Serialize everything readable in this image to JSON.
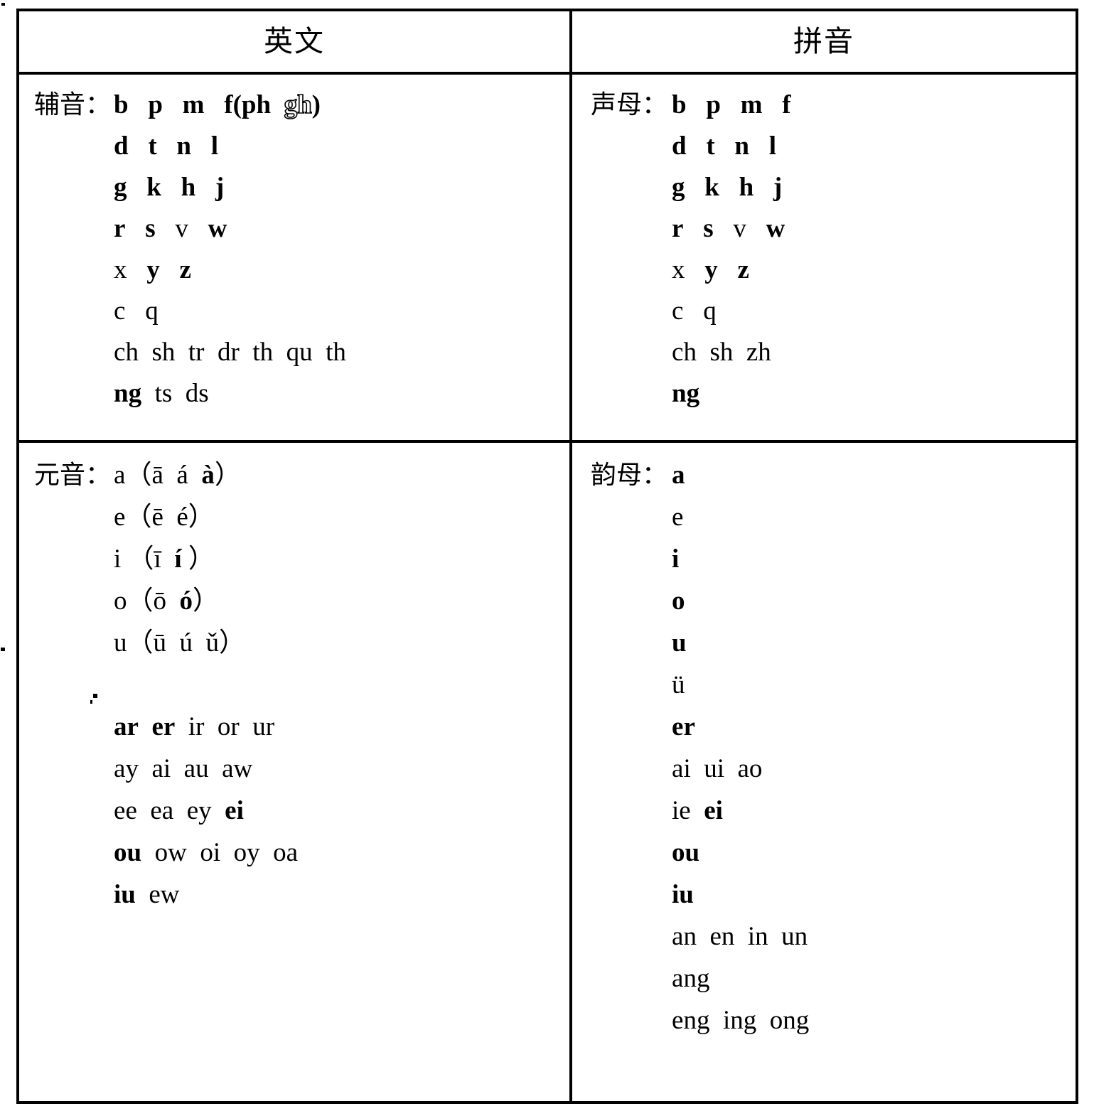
{
  "table": {
    "headers": {
      "english": "英文",
      "pinyin": "拼音"
    },
    "consonants": {
      "english": {
        "label": "辅音：",
        "lines": [
          [
            {
              "t": "b",
              "b": true
            },
            {
              "t": "   "
            },
            {
              "t": "p",
              "b": true
            },
            {
              "t": "   "
            },
            {
              "t": "m",
              "b": true
            },
            {
              "t": "   "
            },
            {
              "t": "f(ph",
              "b": true
            },
            {
              "t": "  "
            },
            {
              "t": "gh",
              "hollow": true
            },
            {
              "t": ")",
              "b": true
            }
          ],
          [
            {
              "t": "d",
              "b": true
            },
            {
              "t": "   "
            },
            {
              "t": "t",
              "b": true
            },
            {
              "t": "   "
            },
            {
              "t": "n",
              "b": true
            },
            {
              "t": "   "
            },
            {
              "t": "l",
              "b": true
            }
          ],
          [
            {
              "t": "g",
              "b": true
            },
            {
              "t": "   "
            },
            {
              "t": "k",
              "b": true
            },
            {
              "t": "   "
            },
            {
              "t": "h",
              "b": true
            },
            {
              "t": "   "
            },
            {
              "t": "j",
              "b": true
            }
          ],
          [
            {
              "t": "r",
              "b": true
            },
            {
              "t": "   "
            },
            {
              "t": "s",
              "b": true
            },
            {
              "t": "   "
            },
            {
              "t": "v"
            },
            {
              "t": "   "
            },
            {
              "t": "w",
              "b": true
            }
          ],
          [
            {
              "t": "x"
            },
            {
              "t": "   "
            },
            {
              "t": "y",
              "b": true
            },
            {
              "t": "   "
            },
            {
              "t": "z",
              "b": true
            }
          ],
          [
            {
              "t": "c"
            },
            {
              "t": "   "
            },
            {
              "t": "q"
            }
          ],
          [
            {
              "t": "ch"
            },
            {
              "t": "  "
            },
            {
              "t": "sh"
            },
            {
              "t": "  "
            },
            {
              "t": "tr"
            },
            {
              "t": "  "
            },
            {
              "t": "dr"
            },
            {
              "t": "  "
            },
            {
              "t": "th"
            },
            {
              "t": "  "
            },
            {
              "t": "qu"
            },
            {
              "t": "  "
            },
            {
              "t": "th"
            }
          ],
          [
            {
              "t": "ng",
              "b": true
            },
            {
              "t": "  "
            },
            {
              "t": "ts"
            },
            {
              "t": "  "
            },
            {
              "t": "ds"
            }
          ]
        ]
      },
      "pinyin": {
        "label": "声母：",
        "lines": [
          [
            {
              "t": "b",
              "b": true
            },
            {
              "t": "   "
            },
            {
              "t": "p",
              "b": true
            },
            {
              "t": "   "
            },
            {
              "t": "m",
              "b": true
            },
            {
              "t": "   "
            },
            {
              "t": "f",
              "b": true
            }
          ],
          [
            {
              "t": "d",
              "b": true
            },
            {
              "t": "   "
            },
            {
              "t": "t",
              "b": true
            },
            {
              "t": "   "
            },
            {
              "t": "n",
              "b": true
            },
            {
              "t": "   "
            },
            {
              "t": "l",
              "b": true
            }
          ],
          [
            {
              "t": "g",
              "b": true
            },
            {
              "t": "   "
            },
            {
              "t": "k",
              "b": true
            },
            {
              "t": "   "
            },
            {
              "t": "h",
              "b": true
            },
            {
              "t": "   "
            },
            {
              "t": "j",
              "b": true
            }
          ],
          [
            {
              "t": "r",
              "b": true
            },
            {
              "t": "   "
            },
            {
              "t": "s",
              "b": true
            },
            {
              "t": "   "
            },
            {
              "t": "v"
            },
            {
              "t": "   "
            },
            {
              "t": "w",
              "b": true
            }
          ],
          [
            {
              "t": "x"
            },
            {
              "t": "   "
            },
            {
              "t": "y",
              "b": true
            },
            {
              "t": "   "
            },
            {
              "t": "z",
              "b": true
            }
          ],
          [
            {
              "t": "c"
            },
            {
              "t": "   "
            },
            {
              "t": "q"
            }
          ],
          [
            {
              "t": "ch"
            },
            {
              "t": "  "
            },
            {
              "t": "sh"
            },
            {
              "t": "  "
            },
            {
              "t": "zh"
            }
          ],
          [
            {
              "t": "ng",
              "b": true
            }
          ]
        ]
      }
    },
    "vowels": {
      "english": {
        "label": "元音：",
        "lines": [
          [
            {
              "t": "a（ā"
            },
            {
              "t": "  "
            },
            {
              "t": "á"
            },
            {
              "t": "  "
            },
            {
              "t": "à",
              "b": true
            },
            {
              "t": "）"
            }
          ],
          [
            {
              "t": "e（ē"
            },
            {
              "t": "  "
            },
            {
              "t": "é）"
            }
          ],
          [
            {
              "t": "i （ī"
            },
            {
              "t": "  "
            },
            {
              "t": "í",
              "b": true
            },
            {
              "t": " ）"
            }
          ],
          [
            {
              "t": "o（ō"
            },
            {
              "t": "  "
            },
            {
              "t": "ó",
              "b": true
            },
            {
              "t": "）"
            }
          ],
          [
            {
              "t": "u（ū"
            },
            {
              "t": "  "
            },
            {
              "t": "ú"
            },
            {
              "t": "  "
            },
            {
              "t": "ǔ）"
            }
          ],
          [],
          [
            {
              "t": "ar",
              "b": true
            },
            {
              "t": "  "
            },
            {
              "t": "er",
              "b": true
            },
            {
              "t": "  "
            },
            {
              "t": "ir"
            },
            {
              "t": "  "
            },
            {
              "t": "or"
            },
            {
              "t": "  "
            },
            {
              "t": "ur"
            }
          ],
          [
            {
              "t": "ay"
            },
            {
              "t": "  "
            },
            {
              "t": "ai"
            },
            {
              "t": "  "
            },
            {
              "t": "au"
            },
            {
              "t": "  "
            },
            {
              "t": "aw"
            }
          ],
          [
            {
              "t": "ee"
            },
            {
              "t": "  "
            },
            {
              "t": "ea"
            },
            {
              "t": "  "
            },
            {
              "t": "ey"
            },
            {
              "t": "  "
            },
            {
              "t": "ei",
              "b": true
            }
          ],
          [
            {
              "t": "ou",
              "b": true
            },
            {
              "t": "  "
            },
            {
              "t": "ow"
            },
            {
              "t": "  "
            },
            {
              "t": "oi"
            },
            {
              "t": "  "
            },
            {
              "t": "oy"
            },
            {
              "t": "  "
            },
            {
              "t": "oa"
            }
          ],
          [
            {
              "t": "iu",
              "b": true
            },
            {
              "t": "  "
            },
            {
              "t": "ew"
            }
          ]
        ]
      },
      "pinyin": {
        "label": "韵母：",
        "lines": [
          [
            {
              "t": "a",
              "b": true
            }
          ],
          [
            {
              "t": "e"
            }
          ],
          [
            {
              "t": "i",
              "b": true
            }
          ],
          [
            {
              "t": "o",
              "b": true
            }
          ],
          [
            {
              "t": "u",
              "b": true
            }
          ],
          [
            {
              "t": "ü"
            }
          ],
          [
            {
              "t": "er",
              "b": true
            }
          ],
          [
            {
              "t": "ai"
            },
            {
              "t": "  "
            },
            {
              "t": "ui"
            },
            {
              "t": "  "
            },
            {
              "t": "ao"
            }
          ],
          [
            {
              "t": "ie"
            },
            {
              "t": "  "
            },
            {
              "t": "ei",
              "b": true
            }
          ],
          [
            {
              "t": "ou",
              "b": true
            }
          ],
          [
            {
              "t": "iu",
              "b": true
            }
          ],
          [
            {
              "t": "an"
            },
            {
              "t": "  "
            },
            {
              "t": "en"
            },
            {
              "t": "  "
            },
            {
              "t": "in"
            },
            {
              "t": "  "
            },
            {
              "t": "un"
            }
          ],
          [
            {
              "t": "ang"
            }
          ],
          [
            {
              "t": "eng"
            },
            {
              "t": "  "
            },
            {
              "t": "ing"
            },
            {
              "t": "  "
            },
            {
              "t": "ong"
            }
          ]
        ]
      }
    }
  }
}
